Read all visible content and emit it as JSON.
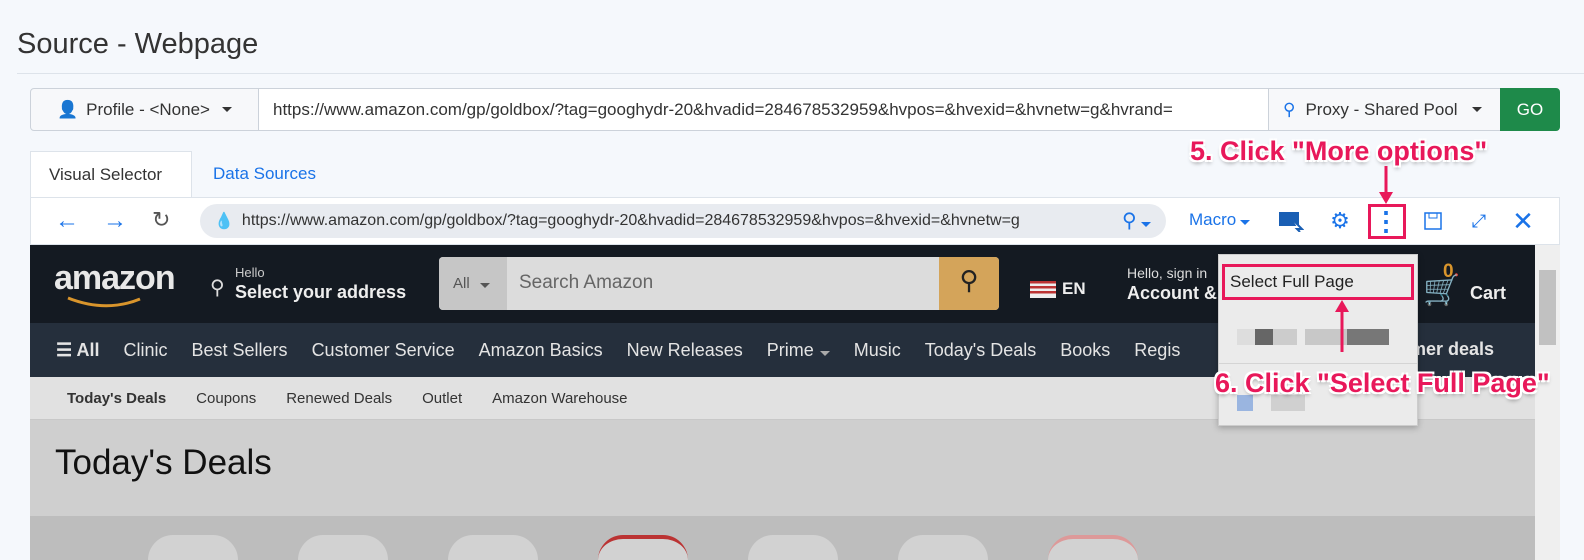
{
  "page_title": "Source - Webpage",
  "toolbar": {
    "profile_label": "Profile - <None>",
    "url": "https://www.amazon.com/gp/goldbox/?tag=googhydr-20&hvadid=284678532959&hvpos=&hvexid=&hvnetw=g&hvrand=",
    "proxy_label": "Proxy - Shared Pool",
    "go_label": "GO"
  },
  "tabs": [
    {
      "label": "Visual Selector",
      "active": true
    },
    {
      "label": "Data Sources",
      "active": false
    }
  ],
  "browser": {
    "address": "https://www.amazon.com/gp/goldbox/?tag=googhydr-20&hvadid=284678532959&hvpos=&hvexid=&hvnetw=g",
    "macro_label": "Macro",
    "icons": [
      "back-icon",
      "forward-icon",
      "reload-icon",
      "location-pin-icon",
      "select-element-icon",
      "gear-icon",
      "more-options-icon",
      "save-icon",
      "expand-icon",
      "close-icon"
    ]
  },
  "amazon": {
    "logo": "amazon",
    "hello": "Hello",
    "address": "Select your address",
    "search_category": "All",
    "search_placeholder": "Search Amazon",
    "lang": "EN",
    "account_hello": "Hello, sign in",
    "account_label": "Account &",
    "cart_count": "0",
    "cart_label": "Cart",
    "nav": [
      "All",
      "Clinic",
      "Best Sellers",
      "Customer Service",
      "Amazon Basics",
      "New Releases",
      "Prime",
      "Music",
      "Today's Deals",
      "Books",
      "Regis"
    ],
    "nav_right": "mer deals",
    "subnav": [
      "Today's Deals",
      "Coupons",
      "Renewed Deals",
      "Outlet",
      "Amazon Warehouse"
    ],
    "heading": "Today's Deals"
  },
  "menu": {
    "items": [
      "Select Full Page"
    ]
  },
  "annotations": {
    "step5": "5. Click \"More options\"",
    "step6": "6. Click \"Select Full Page\""
  },
  "colors": {
    "accent": "#1a73e8",
    "go": "#1e8a4a",
    "annotation": "#e8185a"
  }
}
